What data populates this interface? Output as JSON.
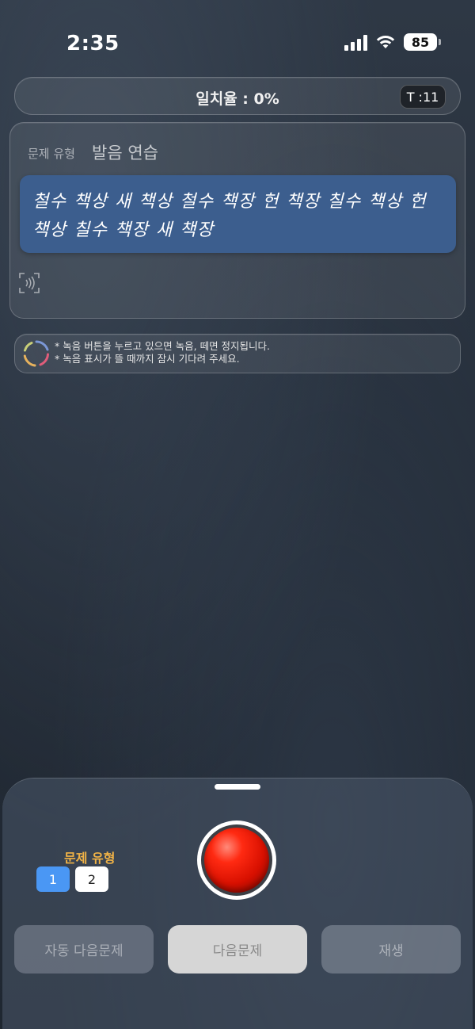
{
  "status_bar": {
    "time": "2:35",
    "battery": "85"
  },
  "match_bar": {
    "text": "일치율 : 0%",
    "timer": "T :11"
  },
  "question": {
    "type_label": "문제 유형",
    "type_value": "발음 연습",
    "sentence": "철수 책상 새 책상 철수 책장 헌 책장 칠수 책상 헌 책상 칠수 책장 새 책장"
  },
  "hints": {
    "line1": "* 녹음 버튼을 누르고 있으면 녹음, 떼면 정지됩니다.",
    "line2": "* 녹음 표시가 뜰 때까지 잠시 기다려 주세요."
  },
  "sheet": {
    "type_label": "문제 유형",
    "type_options": [
      "1",
      "2"
    ],
    "selected_type": "1",
    "buttons": {
      "auto_next": "자동 다음문제",
      "next": "다음문제",
      "play": "재생"
    }
  },
  "colors": {
    "accent_blue": "#4a97f4",
    "sentence_bg": "#3c5e8e",
    "label_orange": "#f0b246",
    "record_red": "#ff2a12"
  },
  "icons": [
    "signal-icon",
    "wifi-icon",
    "battery-icon",
    "nfc-sound-icon",
    "loading-spinner-icon",
    "record-icon"
  ]
}
